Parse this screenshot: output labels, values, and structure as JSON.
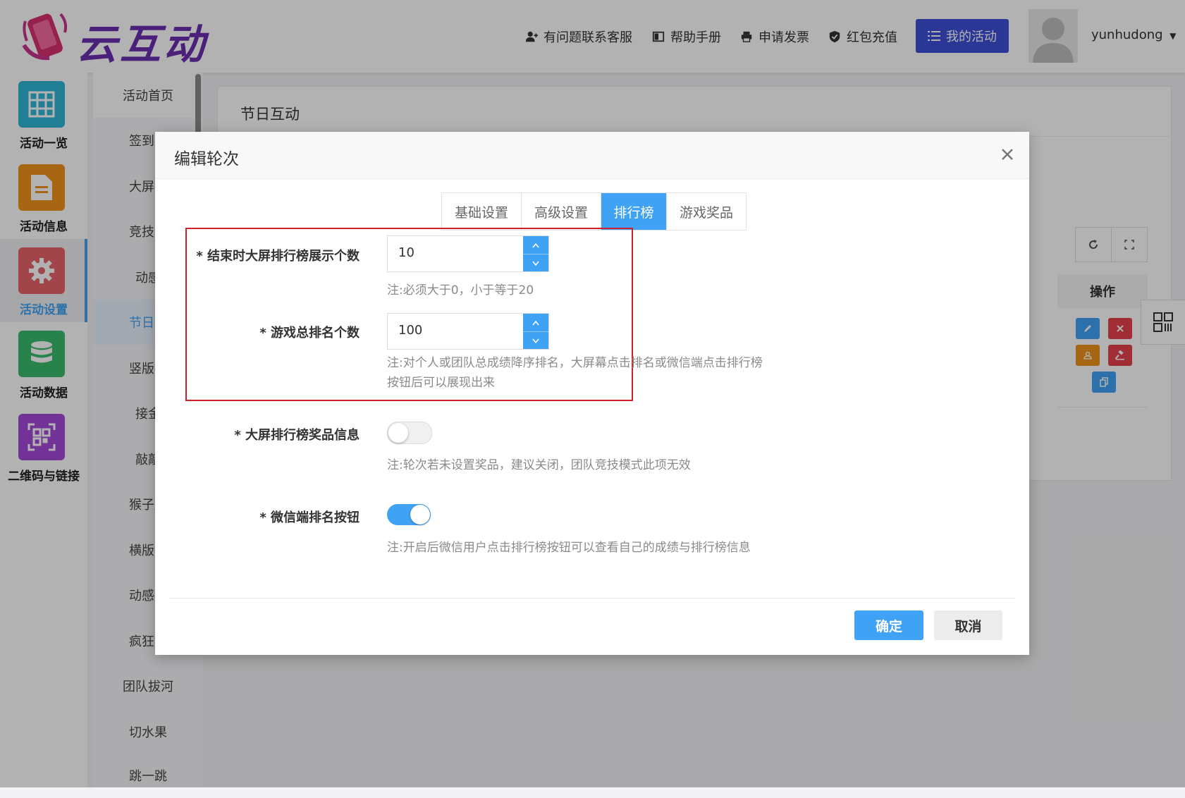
{
  "header": {
    "logo_text": "云互动",
    "links": [
      {
        "label": "有问题联系客服",
        "icon": "add-user-icon"
      },
      {
        "label": "帮助手册",
        "icon": "book-icon"
      },
      {
        "label": "申请发票",
        "icon": "printer-icon"
      },
      {
        "label": "红包充值",
        "icon": "shield-check-icon"
      }
    ],
    "my_activity": "我的活动",
    "username": "yunhudong"
  },
  "leftnav": {
    "items": [
      {
        "label": "活动一览",
        "color": "#2fb5d6"
      },
      {
        "label": "活动信息",
        "color": "#f0931c"
      },
      {
        "label": "活动设置",
        "color": "#e8636b",
        "active": true
      },
      {
        "label": "活动数据",
        "color": "#3aba6e"
      },
      {
        "label": "二维码与链接",
        "color": "#a24ad6"
      }
    ]
  },
  "subnav": {
    "items": [
      "活动首页",
      "签到上",
      "大屏拍",
      "竞技游",
      "动感",
      "节日互",
      "竖版摇",
      "接金",
      "敲敲",
      "猴子爬",
      "横版摇",
      "动感摇",
      "疯狂数",
      "团队拔河",
      "切水果",
      "跳一跳"
    ]
  },
  "main": {
    "title": "节日互动",
    "ops_header": "操作"
  },
  "modal": {
    "title": "编辑轮次",
    "tabs": [
      "基础设置",
      "高级设置",
      "排行榜",
      "游戏奖品"
    ],
    "active_tab": "排行榜",
    "fields": {
      "display_count": {
        "label": "* 结束时大屏排行榜展示个数",
        "value": "10",
        "note": "注:必须大于0，小于等于20"
      },
      "total_rank": {
        "label": "* 游戏总排名个数",
        "value": "100",
        "note_line1": "注:对个人或团队总成绩降序排名，大屏幕点击排名或微信端点击排行榜",
        "note_line2": "按钮后可以展现出来"
      },
      "prize_info": {
        "label": "* 大屏排行榜奖品信息",
        "enabled": false,
        "note": "注:轮次若未设置奖品，建议关闭，团队竞技模式此项无效"
      },
      "wechat_rank_button": {
        "label": "* 微信端排名按钮",
        "enabled": true,
        "note": "注:开启后微信用户点击排行榜按钮可以查看自己的成绩与排行榜信息"
      }
    },
    "ok": "确定",
    "cancel": "取消"
  },
  "colors": {
    "accent": "#3fa2f5",
    "primary_dark": "#3d4fd9",
    "highlight_border": "#d0202c"
  }
}
